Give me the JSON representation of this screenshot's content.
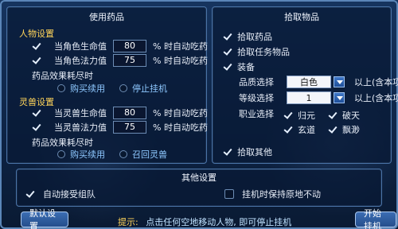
{
  "left_panel": {
    "title": "使用药品",
    "char_section": "人物设置",
    "char_hp_label": "当角色生命值",
    "char_hp_value": "80",
    "char_hp_suffix": "% 时自动吃药",
    "char_mp_label": "当角色法力值",
    "char_mp_value": "75",
    "char_mp_suffix": "% 时自动吃药",
    "char_expire": "药品效果耗尽时",
    "char_buy": "购买续用",
    "char_stop": "停止挂机",
    "pet_section": "灵兽设置",
    "pet_hp_label": "当灵兽生命值",
    "pet_hp_value": "80",
    "pet_hp_suffix": "% 时自动吃药",
    "pet_mp_label": "当灵兽法力值",
    "pet_mp_value": "75",
    "pet_mp_suffix": "% 时自动吃药",
    "pet_expire": "药品效果耗尽时",
    "pet_buy": "购买续用",
    "pet_recall": "召回灵兽"
  },
  "right_panel": {
    "title": "拾取物品",
    "pick_drugs": "拾取药品",
    "pick_quest": "拾取任务物品",
    "equipment": "装备",
    "quality_label": "品质选择",
    "quality_value": "白色",
    "quality_suffix": "以上(含本项)",
    "level_label": "等级选择",
    "level_value": "1",
    "level_suffix": "以上(含本项)",
    "job_label": "职业选择",
    "job_guiyuan": "归元",
    "job_potian": "破天",
    "job_xuandao": "玄道",
    "job_piaomiao": "飘渺",
    "pick_other": "拾取其他"
  },
  "other_panel": {
    "title": "其他设置",
    "auto_team": "自动接受组队",
    "keep_pos": "挂机时保持原地不动"
  },
  "footer": {
    "default_btn": "默认设置",
    "tip_key": "提示:",
    "tip_text": "点击任何空地移动人物, 即可停止挂机",
    "start_btn": "开始挂机"
  }
}
